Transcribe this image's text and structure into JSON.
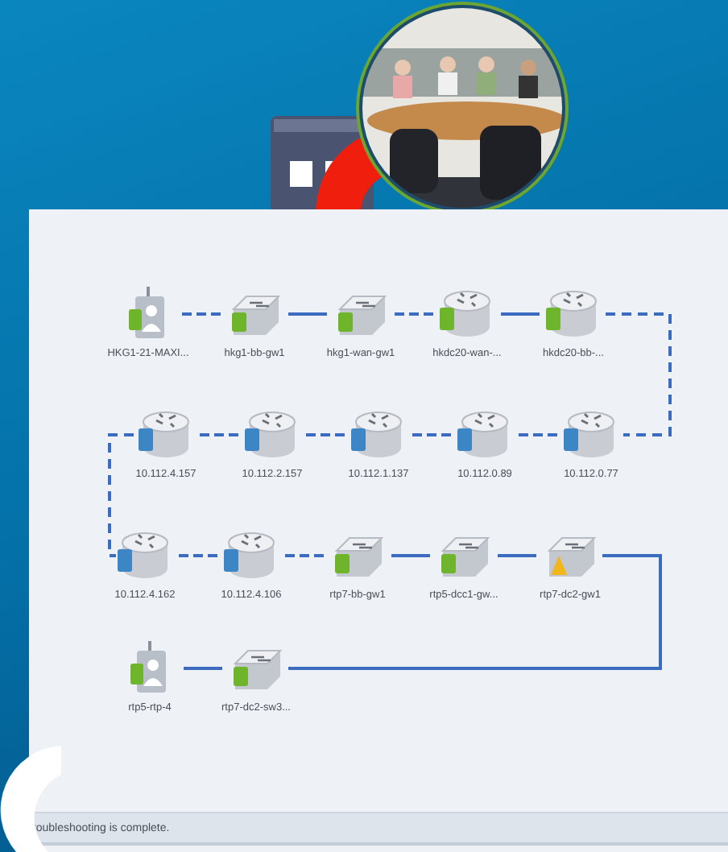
{
  "topology": {
    "rows": [
      {
        "turn_dashed": true,
        "nodes": [
          {
            "label": "HKG1-21-MAXI...",
            "kind": "server",
            "color": "#6fb52c",
            "warning": false,
            "dashed": true
          },
          {
            "label": "hkg1-bb-gw1",
            "kind": "switch",
            "color": "#6fb52c",
            "warning": false,
            "dashed": false
          },
          {
            "label": "hkg1-wan-gw1",
            "kind": "switch",
            "color": "#6fb52c",
            "warning": false,
            "dashed": true
          },
          {
            "label": "hkdc20-wan-...",
            "kind": "router",
            "color": "#6fb52c",
            "warning": false,
            "dashed": false
          },
          {
            "label": "hkdc20-bb-...",
            "kind": "router",
            "color": "#6fb52c",
            "warning": false
          }
        ]
      },
      {
        "turn_dashed": true,
        "nodes": [
          {
            "label": "10.112.4.157",
            "kind": "router",
            "color": "#3d86c6",
            "warning": false,
            "dashed": true
          },
          {
            "label": "10.112.2.157",
            "kind": "router",
            "color": "#3d86c6",
            "warning": false,
            "dashed": true
          },
          {
            "label": "10.112.1.137",
            "kind": "router",
            "color": "#3d86c6",
            "warning": false,
            "dashed": true
          },
          {
            "label": "10.112.0.89",
            "kind": "router",
            "color": "#3d86c6",
            "warning": false,
            "dashed": true
          },
          {
            "label": "10.112.0.77",
            "kind": "router",
            "color": "#3d86c6",
            "warning": false
          }
        ]
      },
      {
        "turn_dashed": false,
        "nodes": [
          {
            "label": "10.112.4.162",
            "kind": "router",
            "color": "#3d86c6",
            "warning": false,
            "dashed": true
          },
          {
            "label": "10.112.4.106",
            "kind": "router",
            "color": "#3d86c6",
            "warning": false,
            "dashed": true
          },
          {
            "label": "rtp7-bb-gw1",
            "kind": "switch",
            "color": "#6fb52c",
            "warning": false,
            "dashed": false
          },
          {
            "label": "rtp5-dcc1-gw...",
            "kind": "switch",
            "color": "#6fb52c",
            "warning": false,
            "dashed": false
          },
          {
            "label": "rtp7-dc2-gw1",
            "kind": "switch",
            "color": "#f2b51c",
            "warning": true
          }
        ]
      },
      {
        "nodes": [
          {
            "label": "rtp5-rtp-4",
            "kind": "server",
            "color": "#6fb52c",
            "warning": false,
            "dashed": false
          },
          {
            "label": "rtp7-dc2-sw3...",
            "kind": "switch",
            "color": "#6fb52c",
            "warning": false
          }
        ]
      }
    ]
  },
  "status_bar": {
    "text": "roubleshooting is complete."
  }
}
